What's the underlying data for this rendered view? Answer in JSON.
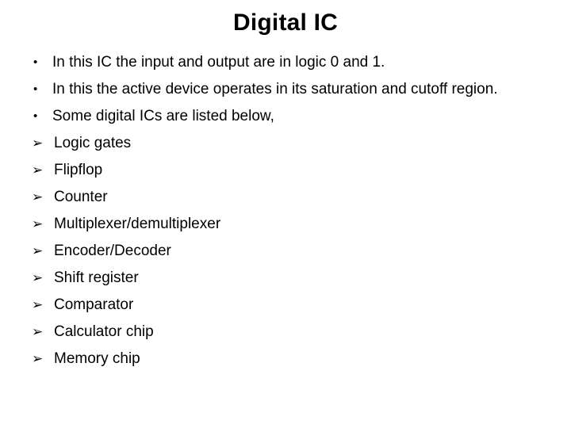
{
  "slide": {
    "title": "Digital IC",
    "background_color": "#ffffff",
    "text_color": "#000000",
    "items": [
      {
        "marker_type": "bullet",
        "marker_glyph": "•",
        "marker_name": "bullet-dot-icon",
        "text": "In this IC the input and output are in logic 0 and 1."
      },
      {
        "marker_type": "bullet",
        "marker_glyph": "•",
        "marker_name": "bullet-dot-icon",
        "text": "In this the active device operates in its saturation and cutoff region."
      },
      {
        "marker_type": "bullet",
        "marker_glyph": "•",
        "marker_name": "bullet-dot-icon",
        "text": "Some digital ICs are listed below,"
      },
      {
        "marker_type": "arrow",
        "marker_glyph": "➢",
        "marker_name": "arrowhead-bullet-icon",
        "text": "Logic gates"
      },
      {
        "marker_type": "arrow",
        "marker_glyph": "➢",
        "marker_name": "arrowhead-bullet-icon",
        "text": "Flipflop"
      },
      {
        "marker_type": "arrow",
        "marker_glyph": "➢",
        "marker_name": "arrowhead-bullet-icon",
        "text": "Counter"
      },
      {
        "marker_type": "arrow",
        "marker_glyph": "➢",
        "marker_name": "arrowhead-bullet-icon",
        "text": "Multiplexer/demultiplexer"
      },
      {
        "marker_type": "arrow",
        "marker_glyph": "➢",
        "marker_name": "arrowhead-bullet-icon",
        "text": "Encoder/Decoder"
      },
      {
        "marker_type": "arrow",
        "marker_glyph": "➢",
        "marker_name": "arrowhead-bullet-icon",
        "text": "Shift register"
      },
      {
        "marker_type": "arrow",
        "marker_glyph": "➢",
        "marker_name": "arrowhead-bullet-icon",
        "text": "Comparator"
      },
      {
        "marker_type": "arrow",
        "marker_glyph": "➢",
        "marker_name": "arrowhead-bullet-icon",
        "text": "Calculator chip"
      },
      {
        "marker_type": "arrow",
        "marker_glyph": "➢",
        "marker_name": "arrowhead-bullet-icon",
        "text": "Memory chip"
      }
    ]
  }
}
